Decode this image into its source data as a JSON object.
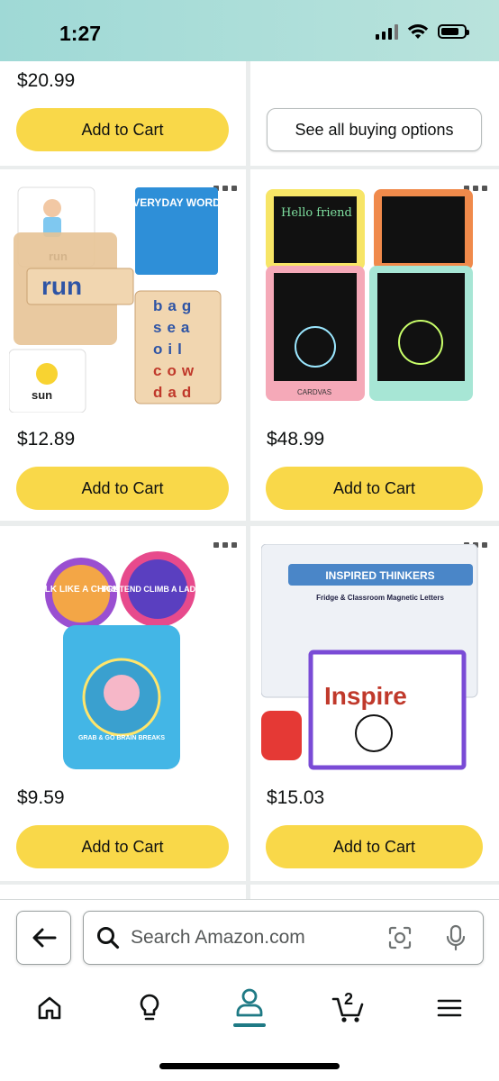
{
  "status_bar": {
    "time": "1:27"
  },
  "products": [
    {
      "price": "$20.99",
      "action": "Add to Cart"
    },
    {
      "price": "",
      "action": "See all buying options"
    },
    {
      "price": "$12.89",
      "action": "Add to Cart",
      "image": "spelling-blocks-toy",
      "image_text": {
        "card1": "run",
        "block": "run",
        "card2": "sun",
        "book": "EVERYDAY WORDS",
        "rows": [
          "bag",
          "sea",
          "oil",
          "cow",
          "dad"
        ]
      }
    },
    {
      "price": "$48.99",
      "action": "Add to Cart",
      "image": "lcd-writing-tablets",
      "image_text": {
        "tablet": "Hello friend",
        "brand": "CARDVAS"
      }
    },
    {
      "price": "$9.59",
      "action": "Add to Cart",
      "image": "brain-break-cards",
      "image_text": {
        "c1": "WALK LIKE A CHICKEN",
        "c2": "PRETEND CLIMB A LADDER",
        "cup": "GRAB & GO BRAIN BREAKS"
      }
    },
    {
      "price": "$15.03",
      "action": "Add to Cart",
      "image": "magnetic-letters",
      "image_text": {
        "brand": "INSPIRED THINKERS",
        "sub": "Fridge & Classroom Magnetic Letters",
        "board": "Inspire"
      }
    }
  ],
  "search": {
    "placeholder": "Search Amazon.com"
  },
  "nav": {
    "cart_count": "2"
  },
  "icons": [
    "back-arrow-icon",
    "search-icon",
    "camera-icon",
    "microphone-icon",
    "home-icon",
    "lightbulb-icon",
    "account-icon",
    "cart-icon",
    "menu-icon",
    "more-dots-icon"
  ],
  "colors": {
    "button_yellow": "#f9d849",
    "status_teal": "#a7dcd8",
    "active_tab": "#1f7a85"
  }
}
